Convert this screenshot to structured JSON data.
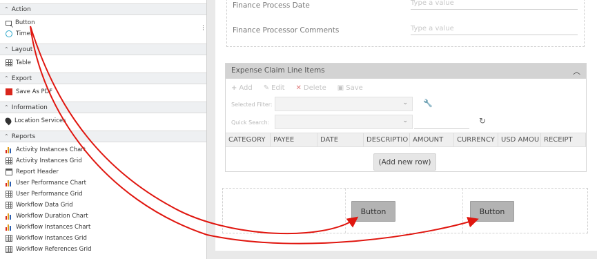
{
  "sidebar": {
    "sections": [
      {
        "title": "Action",
        "items": [
          {
            "label": "Button",
            "icon": "button-select-icon"
          },
          {
            "label": "Timer",
            "icon": "timer-icon"
          }
        ]
      },
      {
        "title": "Layout",
        "items": [
          {
            "label": "Table",
            "icon": "table-icon"
          }
        ]
      },
      {
        "title": "Export",
        "items": [
          {
            "label": "Save As PDF",
            "icon": "pdf-icon"
          }
        ]
      },
      {
        "title": "Information",
        "items": [
          {
            "label": "Location Services",
            "icon": "location-pin-icon"
          }
        ]
      },
      {
        "title": "Reports",
        "items": [
          {
            "label": "Activity Instances Chart",
            "icon": "chart-icon"
          },
          {
            "label": "Activity Instances Grid",
            "icon": "grid-icon"
          },
          {
            "label": "Report Header",
            "icon": "report-header-icon"
          },
          {
            "label": "User Performance Chart",
            "icon": "chart-icon"
          },
          {
            "label": "User Performance Grid",
            "icon": "grid-icon"
          },
          {
            "label": "Workflow Data Grid",
            "icon": "grid-icon"
          },
          {
            "label": "Workflow Duration Chart",
            "icon": "chart-icon"
          },
          {
            "label": "Workflow Instances Chart",
            "icon": "chart-icon"
          },
          {
            "label": "Workflow Instances Grid",
            "icon": "grid-icon"
          },
          {
            "label": "Workflow References Grid",
            "icon": "grid-icon"
          }
        ]
      }
    ]
  },
  "form": {
    "fields": [
      {
        "label": "Finance Process Date",
        "placeholder": "Type a value"
      },
      {
        "label": "Finance Processor Comments",
        "placeholder": "Type a value"
      }
    ]
  },
  "grid": {
    "title": "Expense Claim Line Items",
    "toolbar": {
      "add": "Add",
      "edit": "Edit",
      "delete": "Delete",
      "save": "Save"
    },
    "filters": {
      "selected_filter": "Selected Filter:",
      "quick_search": "Quick Search:"
    },
    "columns": [
      "CATEGORY",
      "PAYEE",
      "DATE",
      "DESCRIPTIO",
      "AMOUNT",
      "CURRENCY",
      "USD AMOU",
      "RECEIPT"
    ],
    "add_row": "(Add new row)"
  },
  "buttons": {
    "button1": "Button",
    "button2": "Button"
  },
  "colors": {
    "arrow": "#e0160f",
    "panel_header": "#d3d3d3",
    "button_bg": "#b3b3b3"
  }
}
